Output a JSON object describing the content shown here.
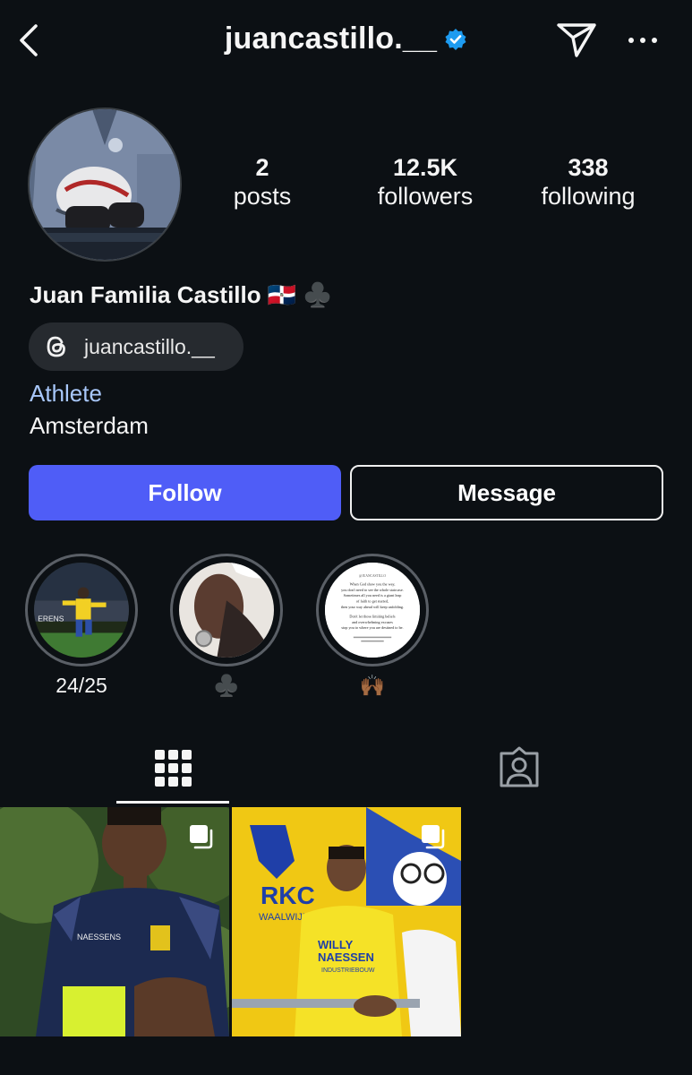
{
  "header": {
    "username": "juancastillo.__",
    "verified": true,
    "icons": [
      "back-chevron-icon",
      "verified-badge-icon",
      "send-icon",
      "more-icon"
    ]
  },
  "profile": {
    "stats": [
      {
        "value": "2",
        "label": "posts"
      },
      {
        "value": "12.5K",
        "label": "followers"
      },
      {
        "value": "338",
        "label": "following"
      }
    ],
    "display_name": "Juan Familia Castillo 🇩🇴 ♣️",
    "threads_handle": "juancastillo.__",
    "category": "Athlete",
    "location": "Amsterdam"
  },
  "actions": {
    "follow_label": "Follow",
    "message_label": "Message"
  },
  "highlights": [
    {
      "caption": "24/25"
    },
    {
      "caption": "♣️"
    },
    {
      "caption": "🙌🏾"
    }
  ],
  "highlight_quote": {
    "heading": "@JUANCASTILLO",
    "lines": [
      "When God show you the way,",
      "you don't need to see the whole staircase.",
      "Sometimes all you need is a giant leap",
      "of faith to get started,",
      "then your way ahead will keep unfolding.",
      "Don't let those limiting beliefs",
      "and overwhelming excuses",
      "stop you to where you are destined to be."
    ]
  },
  "tabs": [
    {
      "name": "posts-grid",
      "icon": "grid-icon",
      "active": true
    },
    {
      "name": "tagged",
      "icon": "tagged-person-icon",
      "active": false
    }
  ],
  "posts": [
    {
      "type": "carousel",
      "icon": "multiple-posts-icon"
    },
    {
      "type": "carousel",
      "icon": "multiple-posts-icon",
      "photo_text": [
        "RKC",
        "WAALWIJK",
        "WILLY",
        "NAESSEN",
        "INDUSTRIEBOUW"
      ]
    }
  ],
  "colors": {
    "background": "#0c1014",
    "follow_button": "#4f5df7",
    "category_link": "#a8c7fa",
    "verified": "#1d9bf0",
    "pill": "#262a2f"
  }
}
